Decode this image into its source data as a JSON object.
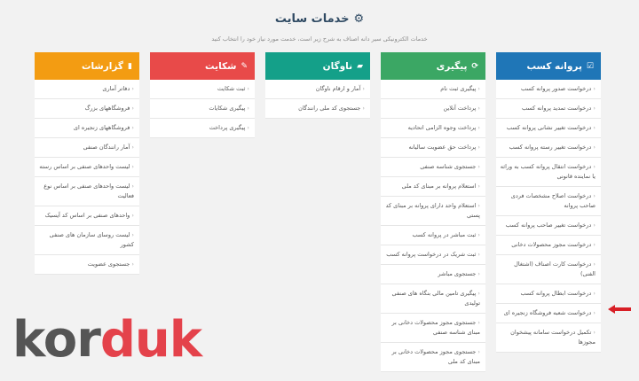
{
  "header": {
    "title": "خدمات سایت",
    "subtitle": "خدمات الکترونیکی سیر دانه اصناف به شرح زیر است، خدمت مورد نیاز خود را انتخاب کنید"
  },
  "columns": [
    {
      "title": "پروانه کسب",
      "icon": "checkbox-icon",
      "items": [
        "درخواست صدور پروانه کسب",
        "درخواست تمدید پروانه کسب",
        "درخواست تغییر نشانی پروانه کسب",
        "درخواست تغییر رسته پروانه کسب",
        "درخواست انتقال پروانه کسب به وراثه یا نماینده قانونی",
        "درخواست اصلاح مشخصات فردی صاحب پروانه",
        "درخواست تغییر صاحب پروانه کسب",
        "درخواست مجوز محصولات دخانی",
        "درخواست کارت اصناف (اشتغال الفنی)",
        "درخواست ابطال پروانه کسب",
        "درخواست شعبه فروشگاه زنجیره ای",
        "تکمیل درخواست سامانه پیشخوان مجوزها"
      ]
    },
    {
      "title": "پیگیری",
      "icon": "refresh-icon",
      "items": [
        "پیگیری ثبت نام",
        "پرداخت آنلاین",
        "پرداخت وجوه الزامی اتحادیه",
        "پرداخت حق عضویت سالیانه",
        "جستجوی شناسه صنفی",
        "استعلام پروانه بر مبنای کد ملی",
        "استعلام واحد دارای پروانه بر مبنای کد پستی",
        "ثبت مباشر در پروانه کسب",
        "ثبت شریک در درخواست پروانه کسب",
        "جستجوی مباشر",
        "پیگیری تامین مالی بنگاه های صنفی تولیدی",
        "جستجوی مجوز محصولات دخانی بر مبنای شناسه صنفی",
        "جستجوی مجوز محصولات دخانی بر مبنای کد ملی"
      ]
    },
    {
      "title": "ناوگان",
      "icon": "truck-icon",
      "items": [
        "آمار و ارقام ناوگان",
        "جستجوی کد ملی رانندگان"
      ]
    },
    {
      "title": "شکایت",
      "icon": "edit-icon",
      "items": [
        "ثبت شکایت",
        "پیگیری شکایات",
        "پیگیری پرداخت"
      ]
    },
    {
      "title": "گزارشات",
      "icon": "chart-icon",
      "items": [
        "دفاتر آماری",
        "فروشگاههای بزرگ",
        "فروشگاههای زنجیره ای",
        "آمار رانندگان صنفی",
        "لیست واحدهای صنفی بر اساس رسته",
        "لیست واحدهای صنفی بر اساس نوع فعالیت",
        "واحدهای صنفی بر اساس کد آیسیک",
        "لیست روسای سازمان های صنفی کشور",
        "جستجوی عضویت"
      ]
    }
  ],
  "logo": {
    "part1": "kor",
    "part2": "duk"
  },
  "colors": {
    "col1": "#1f76b7",
    "col2": "#3ba764",
    "col3": "#14a089",
    "col4": "#e84a49",
    "col5": "#f39c12",
    "arrow": "#d81f26"
  }
}
